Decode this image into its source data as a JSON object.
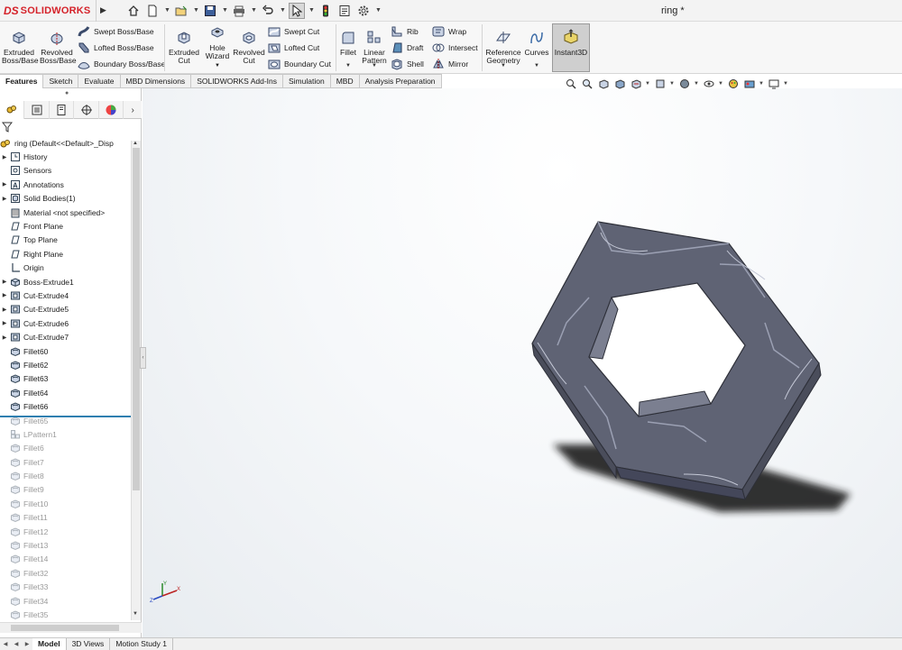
{
  "app": {
    "brand_prefix": "DS",
    "brand_name": "SOLIDWORKS",
    "document_title": "ring *"
  },
  "ribbon": {
    "extruded_boss": "Extruded Boss/Base",
    "revolved_boss": "Revolved Boss/Base",
    "swept_boss": "Swept Boss/Base",
    "lofted_boss": "Lofted Boss/Base",
    "boundary_boss": "Boundary Boss/Base",
    "extruded_cut": "Extruded Cut",
    "hole_wizard": "Hole Wizard",
    "revolved_cut": "Revolved Cut",
    "swept_cut": "Swept Cut",
    "lofted_cut": "Lofted Cut",
    "boundary_cut": "Boundary Cut",
    "fillet": "Fillet",
    "linear_pattern": "Linear Pattern",
    "rib": "Rib",
    "draft": "Draft",
    "shell": "Shell",
    "wrap": "Wrap",
    "intersect": "Intersect",
    "mirror": "Mirror",
    "reference_geometry": "Reference Geometry",
    "curves": "Curves",
    "instant3d": "Instant3D"
  },
  "tabs": [
    "Features",
    "Sketch",
    "Evaluate",
    "MBD Dimensions",
    "SOLIDWORKS Add-Ins",
    "Simulation",
    "MBD",
    "Analysis Preparation"
  ],
  "tree": {
    "root": "ring  (Default<<Default>_Disp",
    "items": [
      {
        "label": "History",
        "icon": "history-icon",
        "expand": true,
        "dim": false
      },
      {
        "label": "Sensors",
        "icon": "sensor-icon",
        "expand": false,
        "dim": false
      },
      {
        "label": "Annotations",
        "icon": "annotation-icon",
        "expand": true,
        "dim": false
      },
      {
        "label": "Solid Bodies(1)",
        "icon": "solid-bodies-icon",
        "expand": true,
        "dim": false
      },
      {
        "label": "Material <not specified>",
        "icon": "material-icon",
        "expand": false,
        "dim": false
      },
      {
        "label": "Front Plane",
        "icon": "plane-icon",
        "expand": false,
        "dim": false
      },
      {
        "label": "Top Plane",
        "icon": "plane-icon",
        "expand": false,
        "dim": false
      },
      {
        "label": "Right Plane",
        "icon": "plane-icon",
        "expand": false,
        "dim": false
      },
      {
        "label": "Origin",
        "icon": "origin-icon",
        "expand": false,
        "dim": false
      },
      {
        "label": "Boss-Extrude1",
        "icon": "extrude-icon",
        "expand": true,
        "dim": false
      },
      {
        "label": "Cut-Extrude4",
        "icon": "cut-extrude-icon",
        "expand": true,
        "dim": false
      },
      {
        "label": "Cut-Extrude5",
        "icon": "cut-extrude-icon",
        "expand": true,
        "dim": false
      },
      {
        "label": "Cut-Extrude6",
        "icon": "cut-extrude-icon",
        "expand": true,
        "dim": false
      },
      {
        "label": "Cut-Extrude7",
        "icon": "cut-extrude-icon",
        "expand": true,
        "dim": false
      },
      {
        "label": "Fillet60",
        "icon": "fillet-icon",
        "expand": false,
        "dim": false
      },
      {
        "label": "Fillet62",
        "icon": "fillet-icon",
        "expand": false,
        "dim": false
      },
      {
        "label": "Fillet63",
        "icon": "fillet-icon",
        "expand": false,
        "dim": false
      },
      {
        "label": "Fillet64",
        "icon": "fillet-icon",
        "expand": false,
        "dim": false
      },
      {
        "label": "Fillet66",
        "icon": "fillet-icon",
        "expand": false,
        "dim": false
      },
      {
        "label": "Fillet65",
        "icon": "fillet-icon",
        "expand": false,
        "dim": true
      },
      {
        "label": "LPattern1",
        "icon": "pattern-icon",
        "expand": false,
        "dim": true
      },
      {
        "label": "Fillet6",
        "icon": "fillet-icon",
        "expand": false,
        "dim": true
      },
      {
        "label": "Fillet7",
        "icon": "fillet-icon",
        "expand": false,
        "dim": true
      },
      {
        "label": "Fillet8",
        "icon": "fillet-icon",
        "expand": false,
        "dim": true
      },
      {
        "label": "Fillet9",
        "icon": "fillet-icon",
        "expand": false,
        "dim": true
      },
      {
        "label": "Fillet10",
        "icon": "fillet-icon",
        "expand": false,
        "dim": true
      },
      {
        "label": "Fillet11",
        "icon": "fillet-icon",
        "expand": false,
        "dim": true
      },
      {
        "label": "Fillet12",
        "icon": "fillet-icon",
        "expand": false,
        "dim": true
      },
      {
        "label": "Fillet13",
        "icon": "fillet-icon",
        "expand": false,
        "dim": true
      },
      {
        "label": "Fillet14",
        "icon": "fillet-icon",
        "expand": false,
        "dim": true
      },
      {
        "label": "Fillet32",
        "icon": "fillet-icon",
        "expand": false,
        "dim": true
      },
      {
        "label": "Fillet33",
        "icon": "fillet-icon",
        "expand": false,
        "dim": true
      },
      {
        "label": "Fillet34",
        "icon": "fillet-icon",
        "expand": false,
        "dim": true
      },
      {
        "label": "Fillet35",
        "icon": "fillet-icon",
        "expand": false,
        "dim": true
      }
    ]
  },
  "bottom_tabs": [
    "Model",
    "3D Views",
    "Motion Study 1"
  ],
  "colors": {
    "brand_red": "#d5222a",
    "part_face": "#5f6374",
    "rollback_bar": "#2f7fb0",
    "suppressed_text": "#9a9a9a"
  }
}
